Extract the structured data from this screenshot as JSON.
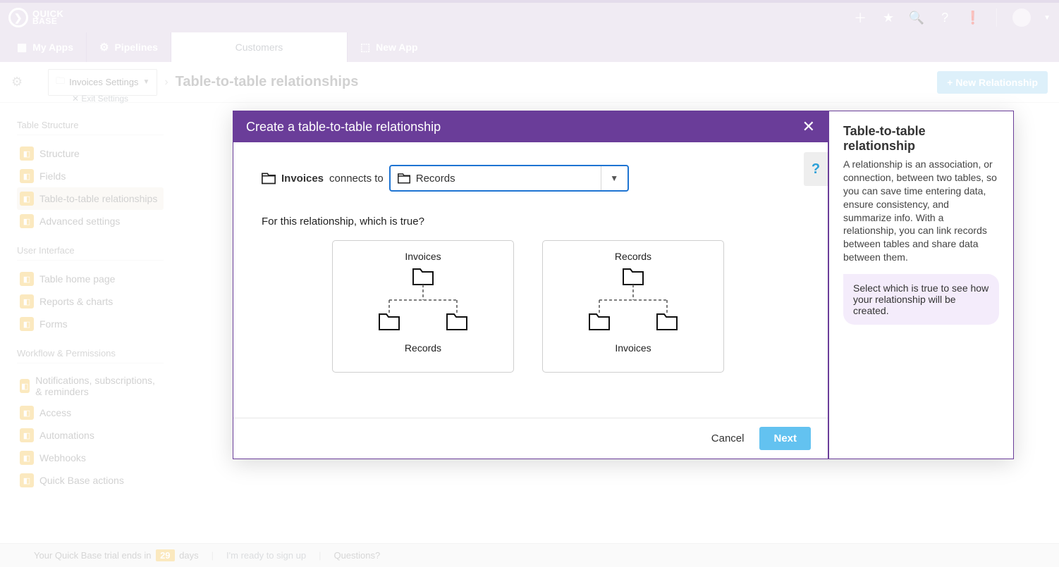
{
  "brand": {
    "line1": "QUICK",
    "line2": "BASE"
  },
  "nav": {
    "my_apps": "My Apps",
    "pipelines": "Pipelines",
    "customers": "Customers",
    "new_app": "New App"
  },
  "page": {
    "settings_pill": "Invoices Settings",
    "exit": "Exit Settings",
    "title": "Table-to-table relationships",
    "new_relationship": "+ New Relationship"
  },
  "sidebar": {
    "groups": [
      {
        "title": "Table Structure",
        "items": [
          "Structure",
          "Fields",
          "Table-to-table relationships",
          "Advanced settings"
        ],
        "activeIndex": 2
      },
      {
        "title": "User Interface",
        "items": [
          "Table home page",
          "Reports & charts",
          "Forms"
        ]
      },
      {
        "title": "Workflow & Permissions",
        "items": [
          "Notifications, subscriptions, & reminders",
          "Access",
          "Automations",
          "Webhooks",
          "Quick Base actions"
        ]
      }
    ]
  },
  "modal": {
    "title": "Create a table-to-table relationship",
    "source_table": "Invoices",
    "connects_to": "connects to",
    "select_value": "Records",
    "question": "For this relationship, which is true?",
    "card1": {
      "top": "Invoices",
      "bottom": "Records"
    },
    "card2": {
      "top": "Records",
      "bottom": "Invoices"
    },
    "cancel": "Cancel",
    "next": "Next",
    "help": "?"
  },
  "helppanel": {
    "title": "Table-to-table relationship",
    "body": "A relationship is an association, or connection, between two tables, so you can save time entering data, ensure consistency, and summarize info. With a relationship, you can link records between tables and share data between them.",
    "hint": "Select which is true to see how your relationship will be created."
  },
  "footer": {
    "trial_pre": "Your Quick Base trial ends in",
    "trial_days": "29",
    "trial_post": "days",
    "signup": "I'm ready to sign up",
    "questions": "Questions?"
  }
}
